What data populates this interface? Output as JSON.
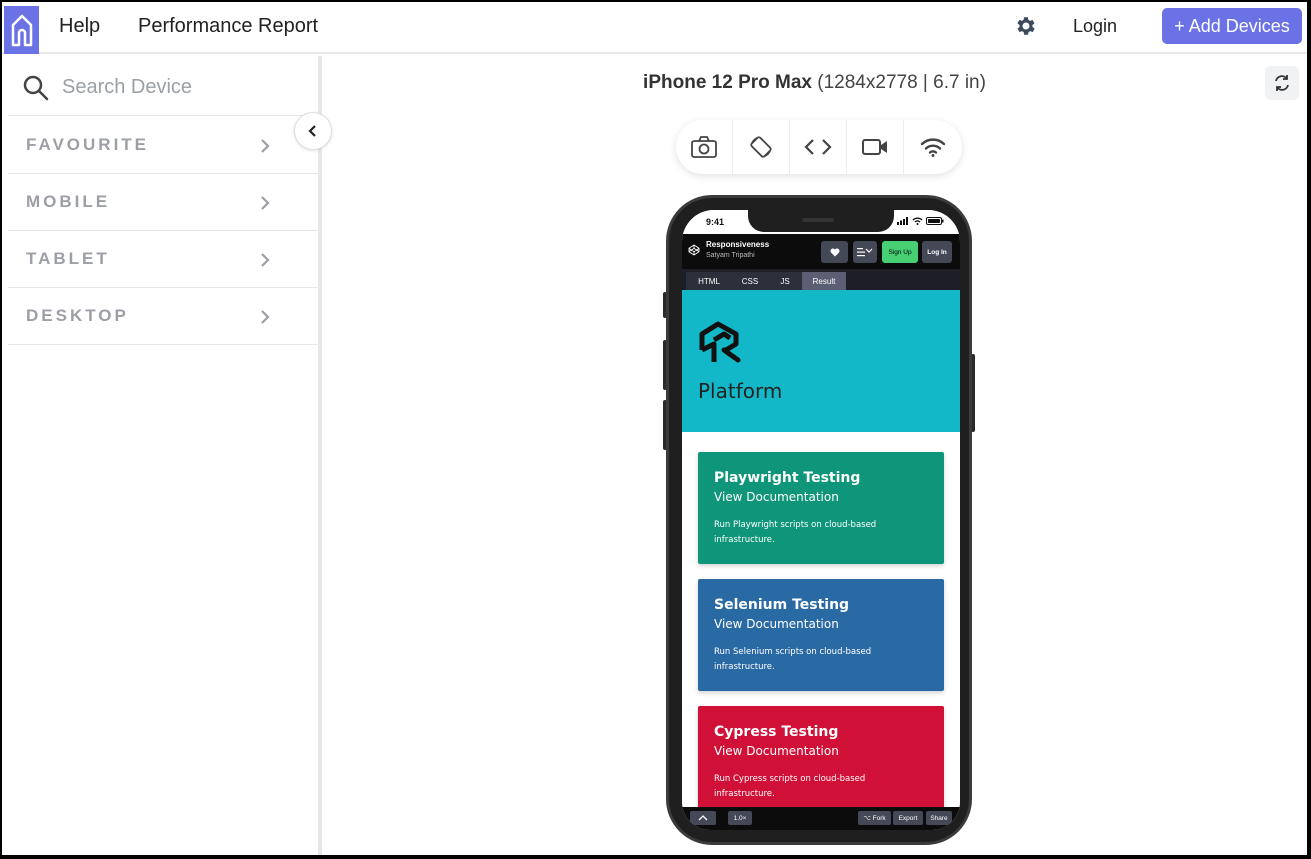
{
  "topbar": {
    "nav": [
      "Help",
      "Performance Report"
    ],
    "login": "Login",
    "add_devices": "+ Add Devices"
  },
  "sidebar": {
    "search_placeholder": "Search Device",
    "categories": [
      "FAVOURITE",
      "MOBILE",
      "TABLET",
      "DESKTOP"
    ]
  },
  "device": {
    "name": "iPhone 12 Pro Max",
    "specs": "(1284x2778 | 6.7 in)"
  },
  "toolbar": {
    "icons": [
      "camera-icon",
      "rotate-icon",
      "code-icon",
      "video-icon",
      "wifi-icon"
    ]
  },
  "phone": {
    "status_time": "9:41",
    "codepen": {
      "title": "Responsiveness",
      "author": "Satyam Tripathi",
      "signup": "Sign Up",
      "login": "Log In",
      "tabs": [
        "HTML",
        "CSS",
        "JS",
        "Result"
      ],
      "active_tab": "Result"
    },
    "hero_title": "Platform",
    "cards": [
      {
        "title": "Playwright Testing",
        "link": "View Documentation",
        "desc": "Run Playwright scripts on cloud-based infrastructure.",
        "color": "#0f967a"
      },
      {
        "title": "Selenium Testing",
        "link": "View Documentation",
        "desc": "Run Selenium scripts on cloud-based infrastructure.",
        "color": "#2a6aa4"
      },
      {
        "title": "Cypress Testing",
        "link": "View Documentation",
        "desc": "Run Cypress scripts on cloud-based infrastructure.",
        "color": "#d01037"
      }
    ],
    "footer": {
      "zoom": "1.0×",
      "fork": "⌥ Fork",
      "export": "Export",
      "share": "Share"
    }
  },
  "colors": {
    "accent": "#6b72e6",
    "hero": "#13b8c8"
  }
}
